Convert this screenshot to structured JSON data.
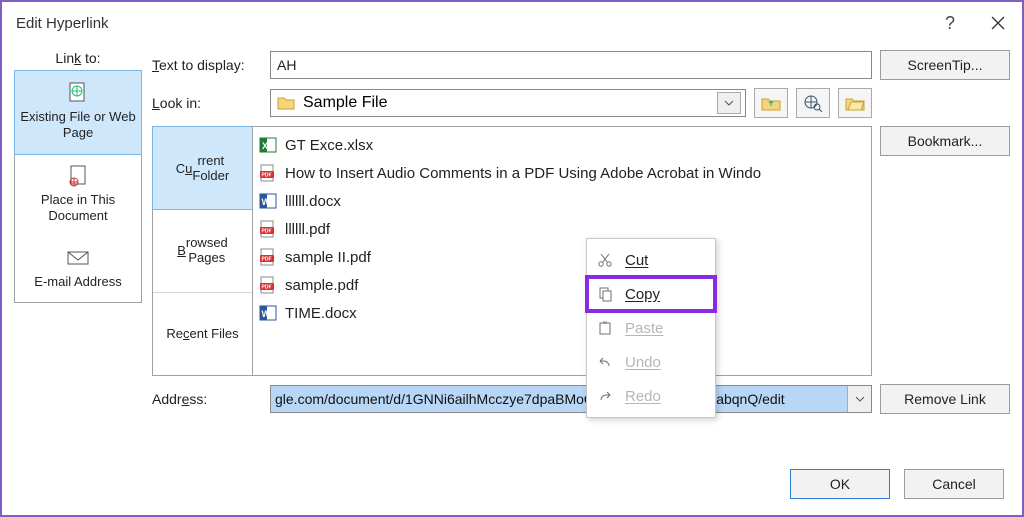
{
  "window": {
    "title": "Edit Hyperlink"
  },
  "linkto": {
    "label_html": "Link to:",
    "items": [
      {
        "label": "Existing File or Web Page",
        "selected": true
      },
      {
        "label": "Place in This Document",
        "selected": false
      },
      {
        "label": "E-mail Address",
        "selected": false
      }
    ]
  },
  "text_to_display": {
    "label": "Text to display:",
    "value": "AH"
  },
  "look_in": {
    "label": "Look in:",
    "value": "Sample File"
  },
  "tabs": [
    {
      "label": "Current Folder",
      "selected": true
    },
    {
      "label": "Browsed Pages",
      "selected": false
    },
    {
      "label": "Recent Files",
      "selected": false
    }
  ],
  "files": [
    {
      "name": "GT Exce.xlsx",
      "icon": "excel"
    },
    {
      "name": "How to Insert Audio Comments in a PDF Using Adobe Acrobat in Windo",
      "icon": "pdf"
    },
    {
      "name": "llllll.docx",
      "icon": "word"
    },
    {
      "name": "llllll.pdf",
      "icon": "pdf"
    },
    {
      "name": "sample II.pdf",
      "icon": "pdf"
    },
    {
      "name": "sample.pdf",
      "icon": "pdf"
    },
    {
      "name": "TIME.docx",
      "icon": "word"
    }
  ],
  "address": {
    "label": "Address:",
    "value": "gle.com/document/d/1GNNi6ailhMcczye7dpaBMoQpCUDFtqkF7Pk397abqnQ/edit"
  },
  "right_buttons": {
    "screentip": "ScreenTip...",
    "bookmark": "Bookmark...",
    "remove": "Remove Link"
  },
  "bottom_buttons": {
    "ok": "OK",
    "cancel": "Cancel"
  },
  "context_menu": {
    "items": [
      {
        "label": "Cut",
        "enabled": true,
        "highlight": false,
        "icon": "cut"
      },
      {
        "label": "Copy",
        "enabled": true,
        "highlight": true,
        "icon": "copy"
      },
      {
        "label": "Paste",
        "enabled": false,
        "highlight": false,
        "icon": "paste"
      },
      {
        "label": "Undo",
        "enabled": false,
        "highlight": false,
        "icon": "undo"
      },
      {
        "label": "Redo",
        "enabled": false,
        "highlight": false,
        "icon": "redo"
      }
    ]
  }
}
